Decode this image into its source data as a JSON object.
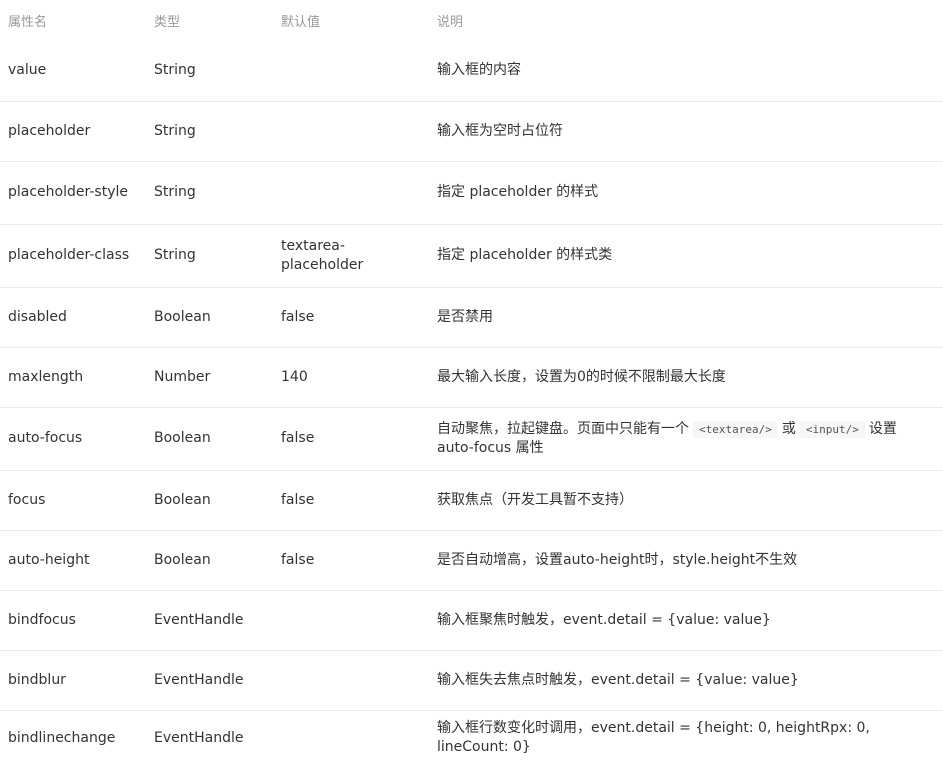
{
  "table": {
    "headers": [
      "属性名",
      "类型",
      "默认值",
      "说明"
    ],
    "rows": [
      {
        "name": "value",
        "type": "String",
        "default": "",
        "desc": "输入框的内容"
      },
      {
        "name": "placeholder",
        "type": "String",
        "default": "",
        "desc": "输入框为空时占位符"
      },
      {
        "name": "placeholder-style",
        "type": "String",
        "default": "",
        "desc": "指定 placeholder 的样式"
      },
      {
        "name": "placeholder-class",
        "type": "String",
        "default": "textarea-placeholder",
        "desc": "指定 placeholder 的样式类"
      },
      {
        "name": "disabled",
        "type": "Boolean",
        "default": "false",
        "desc": "是否禁用"
      },
      {
        "name": "maxlength",
        "type": "Number",
        "default": "140",
        "desc": "最大输入长度，设置为0的时候不限制最大长度"
      },
      {
        "name": "auto-focus",
        "type": "Boolean",
        "default": "false",
        "desc_prefix": "自动聚焦，拉起键盘。页面中只能有一个",
        "code1": "<textarea/>",
        "desc_or": "或",
        "code2": "<input/>",
        "desc_suffix": "设置 auto-focus 属性"
      },
      {
        "name": "focus",
        "type": "Boolean",
        "default": "false",
        "desc": "获取焦点（开发工具暂不支持）"
      },
      {
        "name": "auto-height",
        "type": "Boolean",
        "default": "false",
        "desc": "是否自动增高，设置auto-height时，style.height不生效"
      },
      {
        "name": "bindfocus",
        "type": "EventHandle",
        "default": "",
        "desc": "输入框聚焦时触发，event.detail = {value: value}"
      },
      {
        "name": "bindblur",
        "type": "EventHandle",
        "default": "",
        "desc": "输入框失去焦点时触发，event.detail = {value: value}"
      },
      {
        "name": "bindlinechange",
        "type": "EventHandle",
        "default": "",
        "desc": "输入框行数变化时调用，event.detail = {height: 0, heightRpx: 0, lineCount: 0}"
      }
    ]
  }
}
